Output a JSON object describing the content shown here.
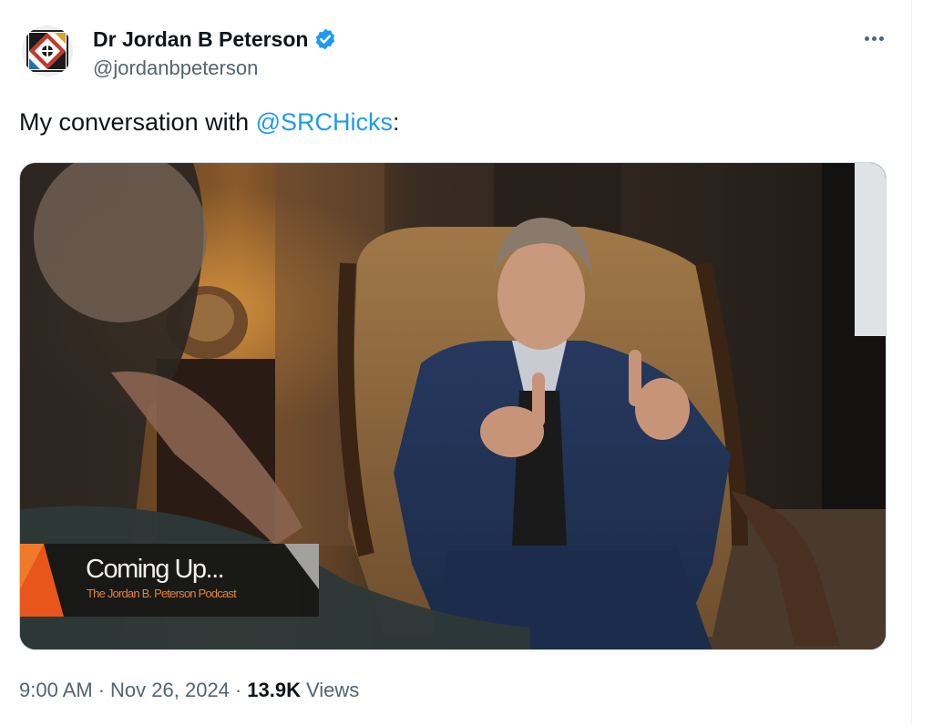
{
  "author": {
    "display_name": "Dr Jordan B Peterson",
    "handle": "@jordanbpeterson",
    "verified": true,
    "verified_color": "#1d9bf0"
  },
  "tweet": {
    "text_prefix": "My conversation with ",
    "mention": "@SRCHicks",
    "text_suffix": ":"
  },
  "media": {
    "overlay_title": "Coming Up...",
    "overlay_subtitle": "The Jordan B. Peterson Podcast"
  },
  "meta": {
    "time": "9:00 AM",
    "separator": "·",
    "date": "Nov 26, 2024",
    "views_count": "13.9K",
    "views_label": "Views"
  },
  "colors": {
    "text_primary": "#0f1419",
    "text_secondary": "#536471",
    "link": "#1d9bf0",
    "accent_orange": "#e8561c"
  },
  "icons": {
    "more": "more-options-icon",
    "verified": "verified-badge-icon"
  }
}
